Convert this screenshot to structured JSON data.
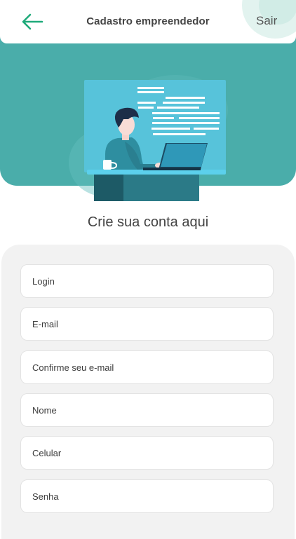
{
  "header": {
    "title": "Cadastro empreendedor",
    "exit_label": "Sair"
  },
  "main": {
    "subtitle": "Crie sua conta aqui"
  },
  "form": {
    "fields": [
      {
        "placeholder": "Login",
        "value": ""
      },
      {
        "placeholder": "E-mail",
        "value": ""
      },
      {
        "placeholder": "Confirme seu e-mail",
        "value": ""
      },
      {
        "placeholder": "Nome",
        "value": ""
      },
      {
        "placeholder": "Celular",
        "value": ""
      },
      {
        "placeholder": "Senha",
        "value": ""
      }
    ]
  },
  "colors": {
    "accent_green": "#1faa7a",
    "hero_teal": "#4aadaa",
    "form_background": "#f2f2f2"
  },
  "icons": {
    "back": "arrow-left-icon",
    "illustration": "person-at-laptop-illustration"
  }
}
